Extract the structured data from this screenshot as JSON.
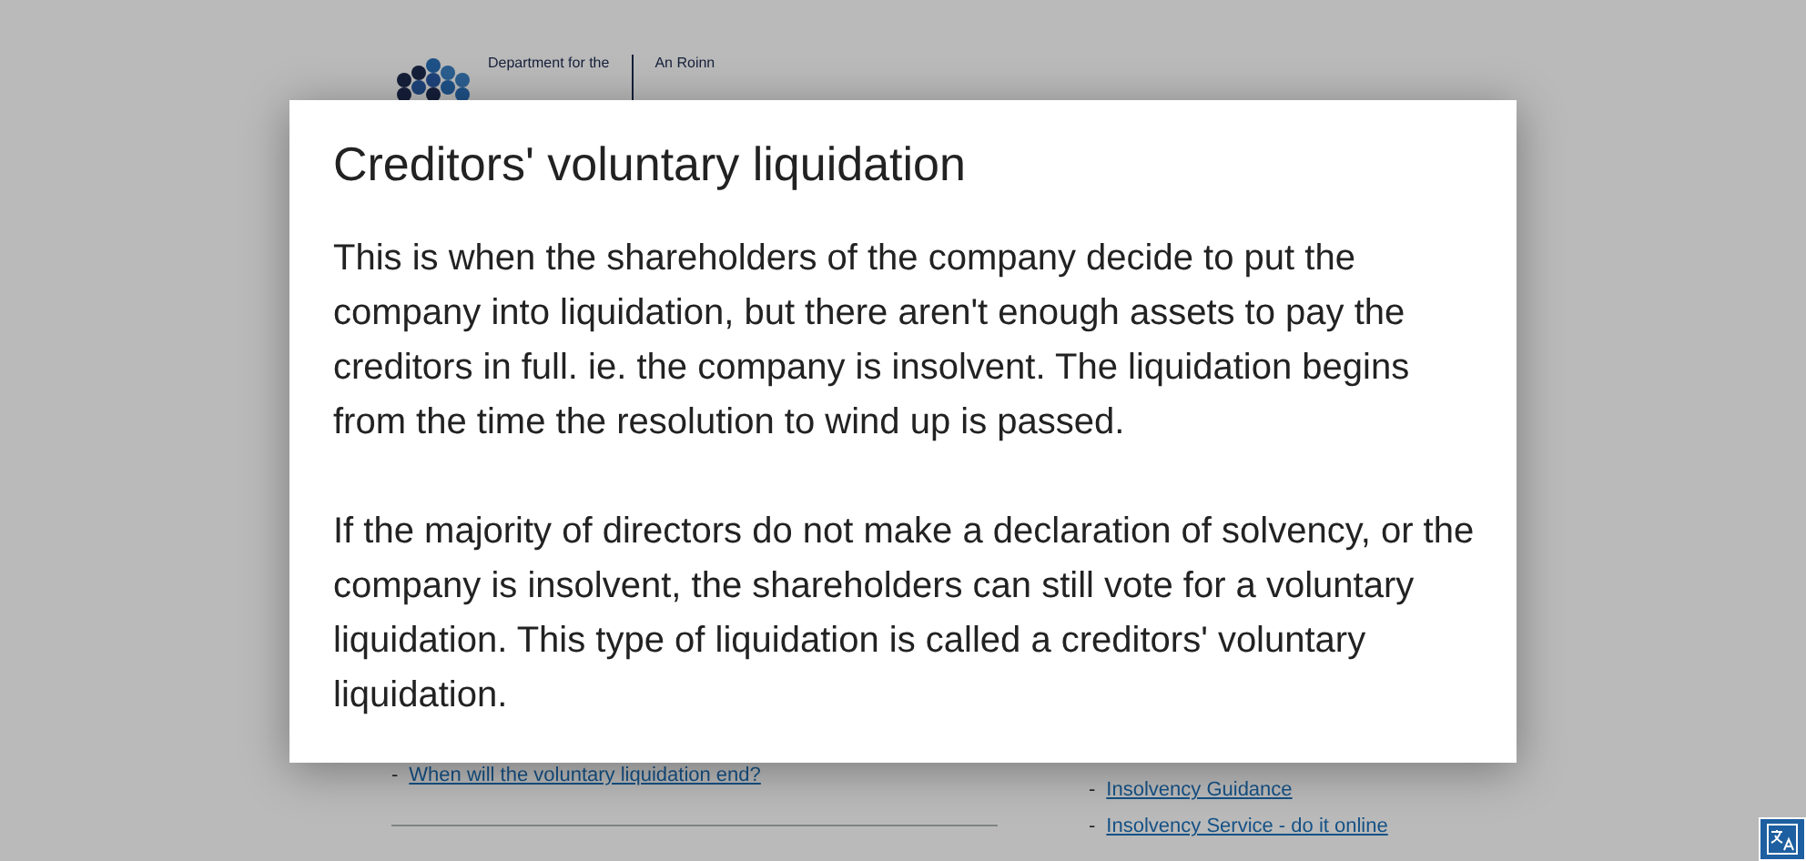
{
  "background_page": {
    "logo": {
      "department_prefix": "Department for the",
      "irish_prefix": "An Roinn"
    },
    "left_links": [
      {
        "bullet": "-",
        "label": "When will the voluntary liquidation end?"
      }
    ],
    "related_links": [
      {
        "bullet": "-",
        "label": "Insolvency Guidance"
      },
      {
        "bullet": "-",
        "label": "Insolvency Service - do it online"
      }
    ]
  },
  "dialog": {
    "title": "Creditors' voluntary liquidation",
    "paragraphs": [
      "This is when the shareholders of the company decide to put the company into liquidation, but there aren't enough assets to pay the creditors in full. ie. the company is insolvent. The liquidation begins from the time the resolution to wind up is passed.",
      "If the majority of directors do not make a declaration of solvency, or the company is insolvent, the shareholders can still vote for a voluntary liquidation. This type of liquidation is called a creditors' voluntary liquidation."
    ]
  }
}
